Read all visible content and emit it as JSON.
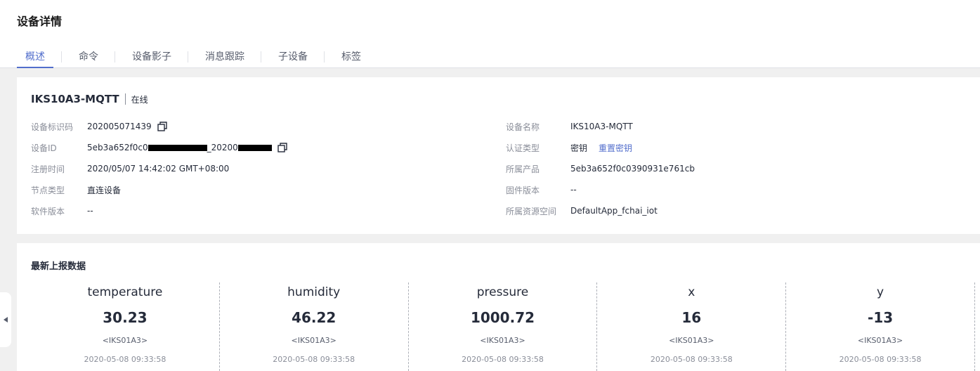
{
  "page": {
    "title": "设备详情"
  },
  "tabs": [
    {
      "label": "概述"
    },
    {
      "label": "命令"
    },
    {
      "label": "设备影子"
    },
    {
      "label": "消息跟踪"
    },
    {
      "label": "子设备"
    },
    {
      "label": "标签"
    }
  ],
  "device": {
    "name": "IKS10A3-MQTT",
    "status": "在线",
    "left": [
      {
        "label": "设备标识码",
        "value": "202005071439"
      },
      {
        "label": "设备ID",
        "value_prefix": "5eb3a652f0c0",
        "value_mid": "_20200"
      },
      {
        "label": "注册时间",
        "value": "2020/05/07 14:42:02 GMT+08:00"
      },
      {
        "label": "节点类型",
        "value": "直连设备"
      },
      {
        "label": "软件版本",
        "value": "--"
      }
    ],
    "right": [
      {
        "label": "设备名称",
        "value": "IKS10A3-MQTT"
      },
      {
        "label": "认证类型",
        "value": "密钥",
        "link": "重置密钥"
      },
      {
        "label": "所属产品",
        "value": "5eb3a652f0c0390931e761cb"
      },
      {
        "label": "固件版本",
        "value": "--"
      },
      {
        "label": "所属资源空间",
        "value": "DefaultApp_fchai_iot"
      }
    ]
  },
  "latest_data": {
    "title": "最新上报数据",
    "metrics": [
      {
        "name": "temperature",
        "value": "30.23",
        "source": "<IKS01A3>",
        "time": "2020-05-08 09:33:58"
      },
      {
        "name": "humidity",
        "value": "46.22",
        "source": "<IKS01A3>",
        "time": "2020-05-08 09:33:58"
      },
      {
        "name": "pressure",
        "value": "1000.72",
        "source": "<IKS01A3>",
        "time": "2020-05-08 09:33:58"
      },
      {
        "name": "x",
        "value": "16",
        "source": "<IKS01A3>",
        "time": "2020-05-08 09:33:58"
      },
      {
        "name": "y",
        "value": "-13",
        "source": "<IKS01A3>",
        "time": "2020-05-08 09:33:58"
      }
    ]
  },
  "icons": {
    "copy": "copy-icon",
    "collapse": "caret-left-icon"
  },
  "colors": {
    "accent": "#526ecc",
    "label": "#8a8e99",
    "text": "#252b3a"
  }
}
